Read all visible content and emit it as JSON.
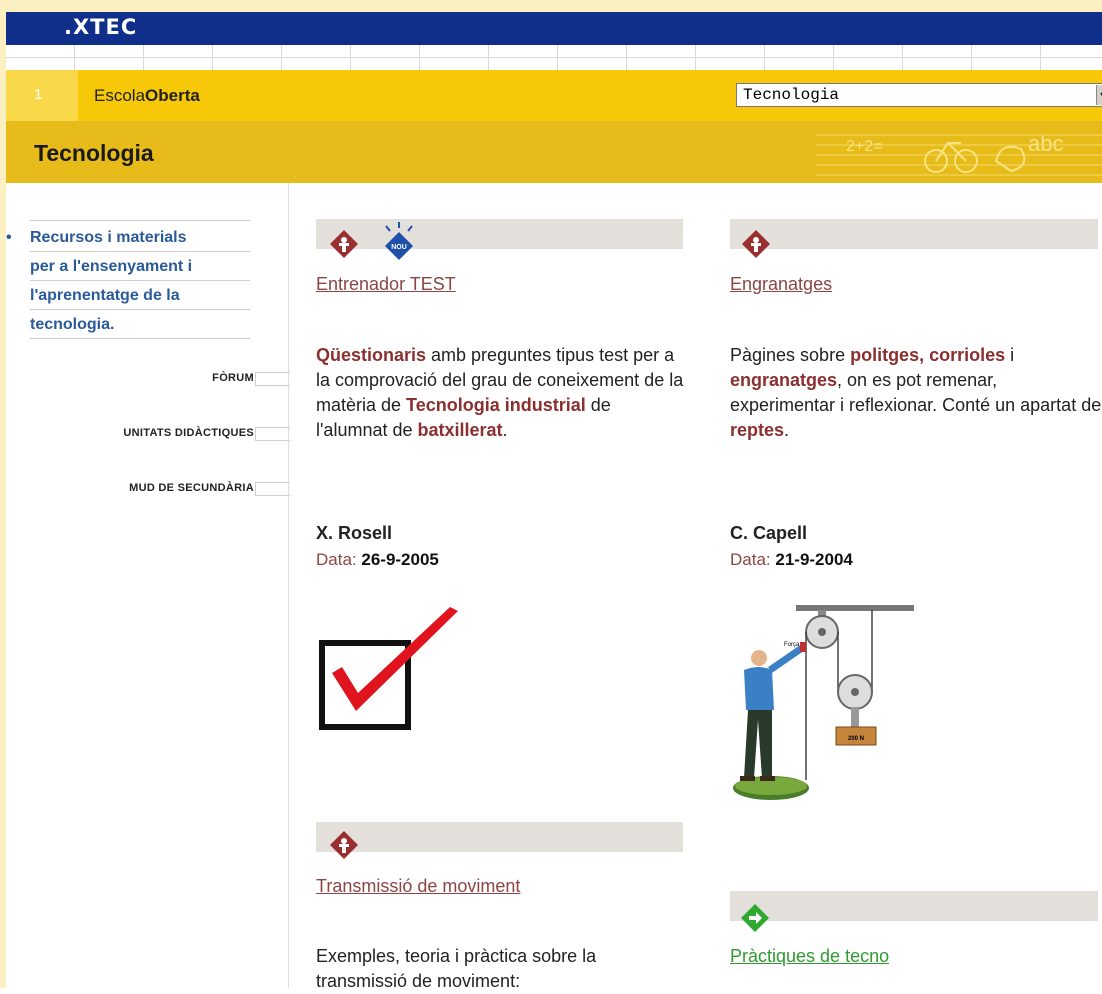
{
  "xtec": {
    "logo": ".XTEC"
  },
  "escola": {
    "number": "1",
    "label_a": "Escola",
    "label_b": "Oberta"
  },
  "select": {
    "value": "Tecnologia",
    "arrow": "▼"
  },
  "page": {
    "title": "Tecnologia",
    "deco_text": "2+2=",
    "deco_abc": "abc"
  },
  "sidebar": {
    "bullet": "•",
    "link_lines": [
      "Recursos i materials",
      "per a l'ensenyament i",
      "l'aprenentatge de la",
      "tecnologia."
    ],
    "nav": [
      "FÒRUM",
      "UNITATS DIDÀCTIQUES",
      "MUD DE SECUNDÀRIA"
    ]
  },
  "badge_new": "NOU",
  "cards": [
    {
      "title": "Entrenador TEST",
      "desc_parts": [
        {
          "t": "Qüestionaris",
          "h": true
        },
        {
          "t": " amb preguntes tipus test per a la comprovació del grau de coneixement de la matèria de ",
          "h": false
        },
        {
          "t": "Tecnologia industrial",
          "h": true
        },
        {
          "t": " de l'alumnat de ",
          "h": false
        },
        {
          "t": "batxillerat",
          "h": true
        },
        {
          "t": ".",
          "h": false
        }
      ],
      "author": "X. Rosell",
      "date_label": "Data:",
      "date_value": "26-9-2005"
    },
    {
      "title": "Engranatges",
      "desc_parts": [
        {
          "t": "Pàgines sobre ",
          "h": false
        },
        {
          "t": "politges",
          "h": true
        },
        {
          "t": ", ",
          "h": false
        },
        {
          "t": "corrioles",
          "h": true
        },
        {
          "t": " i ",
          "h": false
        },
        {
          "t": "engranatges",
          "h": true
        },
        {
          "t": ", on es pot remenar, experimentar i reflexionar. Conté un apartat de ",
          "h": false
        },
        {
          "t": "reptes",
          "h": true
        },
        {
          "t": ".",
          "h": false
        }
      ],
      "author": "C. Capell",
      "date_label": "Data:",
      "date_value": "21-9-2004",
      "figure_label_a": "Força",
      "figure_label_b": "200 N"
    },
    {
      "title": "Transmissió de moviment",
      "desc": "Exemples, teoria i pràctica sobre la transmissió de moviment:"
    },
    {
      "title": "Pràctiques de tecno"
    }
  ],
  "colors": {
    "brand_blue": "#0f2f8a",
    "yellow": "#f6c807",
    "link_brown": "#8c4545",
    "link_green": "#2f9a2f"
  }
}
